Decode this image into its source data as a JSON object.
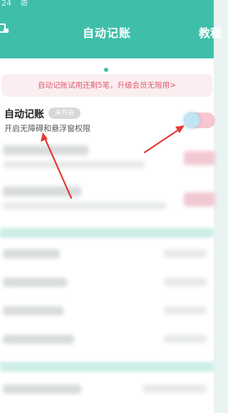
{
  "status_bar": {
    "time": "24",
    "glyph": "A"
  },
  "header": {
    "title": "自动记账",
    "tutorial": "教程"
  },
  "promo": {
    "text": "自动记账试用还剩5笔，升级会员无限用>"
  },
  "auto_record": {
    "title": "自动记账",
    "status": "未开启",
    "subtitle": "开启无障碍和悬浮窗权限",
    "toggle_on": false
  },
  "colors": {
    "header": "#3fbfaa",
    "promo_text": "#e05a6e",
    "annotation_arrow": "#e53935"
  }
}
